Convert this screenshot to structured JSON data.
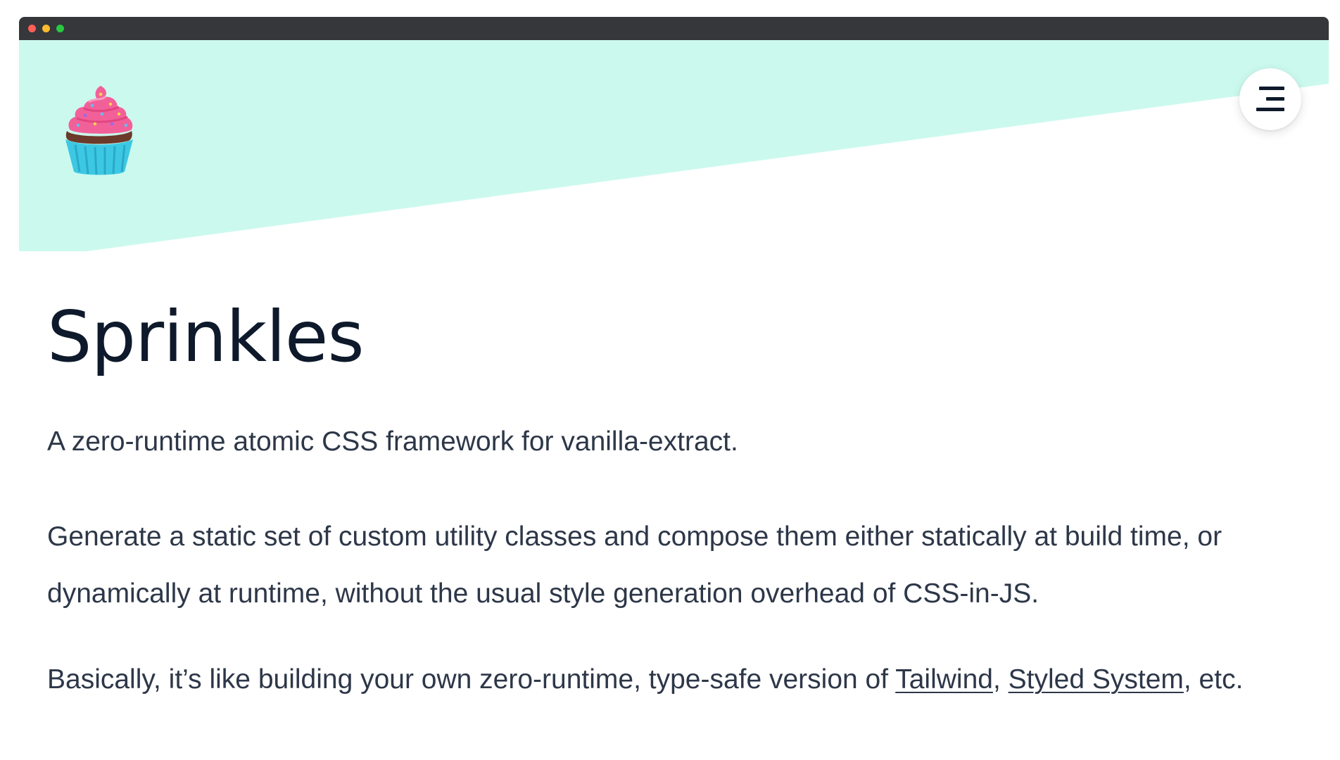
{
  "window": {
    "controls": [
      "close",
      "minimize",
      "maximize"
    ]
  },
  "header": {
    "logo_icon": "cupcake-icon",
    "menu_icon": "menu-icon"
  },
  "colors": {
    "hero_background": "#ccf9ee",
    "titlebar": "#36373a",
    "heading": "#0e1a2b",
    "body_text": "#2d3748"
  },
  "main": {
    "title": "Sprinkles",
    "tagline": "A zero-runtime atomic CSS framework for vanilla-extract.",
    "description": "Generate a static set of custom utility classes and compose them either statically at build time, or dynamically at runtime, without the usual style generation overhead of CSS-in-JS.",
    "basically": {
      "prefix": "Basically, it’s like building your own zero-runtime, type-safe version of ",
      "link1": "Tailwind",
      "separator": ", ",
      "link2": "Styled System",
      "suffix": ", etc."
    }
  }
}
